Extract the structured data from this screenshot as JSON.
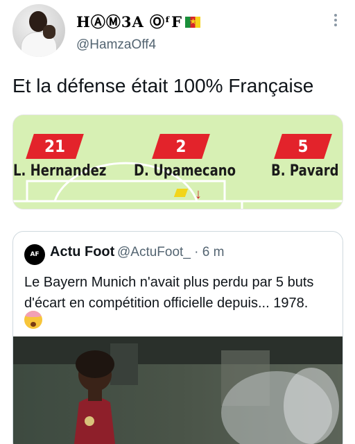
{
  "tweet": {
    "display_name": "HⒶⓂ3A ⓄᶠF",
    "handle": "@HamzaOff4",
    "text": "Et la défense était 100% Française",
    "flag_icon": "cameroon-flag-icon"
  },
  "lineup": {
    "players": [
      {
        "number": "21",
        "name": "L. Hernandez"
      },
      {
        "number": "2",
        "name": "D. Upamecano"
      },
      {
        "number": "5",
        "name": "B. Pavard"
      }
    ],
    "colors": {
      "pitch": "#d7f0b4",
      "number_badge": "#e3232b",
      "card": "#f2d51a"
    }
  },
  "quoted_tweet": {
    "avatar_text": "AF",
    "name": "Actu Foot",
    "meta": "@ActuFoot_ · 6 m",
    "text": "Le Bayern Munich n'avait plus perdu par 5 buts d'écart en compétition officielle depuis... 1978.",
    "emoji": "exploding-head-emoji"
  }
}
